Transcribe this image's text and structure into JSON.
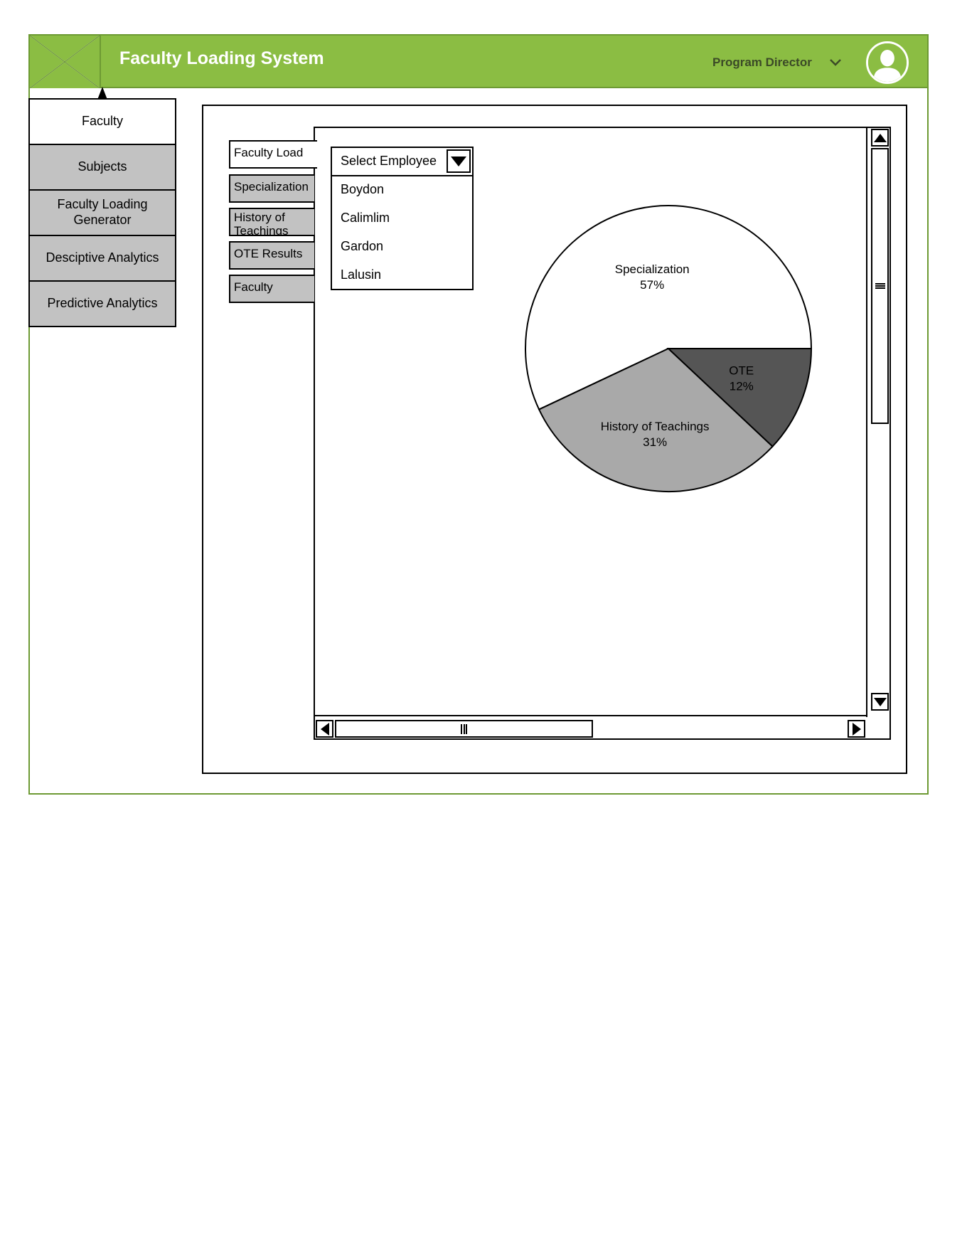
{
  "header": {
    "title": "Faculty Loading System",
    "role": "Program Director",
    "accent_color": "#8bbd43",
    "icons": {
      "logo": "image-placeholder-icon",
      "role_toggle": "chevron-down-icon",
      "avatar": "user-silhouette-icon"
    }
  },
  "sidebar": {
    "items": [
      {
        "label": "Faculty",
        "active": true
      },
      {
        "label": "Subjects",
        "active": false
      },
      {
        "label": "Faculty Loading Generator",
        "active": false
      },
      {
        "label": "Desciptive Analytics",
        "active": false
      },
      {
        "label": "Predictive Analytics",
        "active": false
      }
    ]
  },
  "tabs": [
    {
      "label": "Faculty Load",
      "active": true
    },
    {
      "label": "Specialization",
      "active": false
    },
    {
      "label": "History of Teachings",
      "active": false
    },
    {
      "label": "OTE Results",
      "active": false
    },
    {
      "label": "Faculty",
      "active": false
    }
  ],
  "employee_select": {
    "label": "Select Employee",
    "options": [
      "Boydon",
      "Calimlim",
      "Gardon",
      "Lalusin"
    ]
  },
  "chart_data": {
    "type": "pie",
    "series": [
      {
        "name": "Specialization",
        "value": 57,
        "label": "57%",
        "color": "#ffffff"
      },
      {
        "name": "History of Teachings",
        "value": 31,
        "label": "31%",
        "color": "#a9a9a9"
      },
      {
        "name": "OTE",
        "value": 12,
        "label": "12%",
        "color": "#555555"
      }
    ]
  }
}
